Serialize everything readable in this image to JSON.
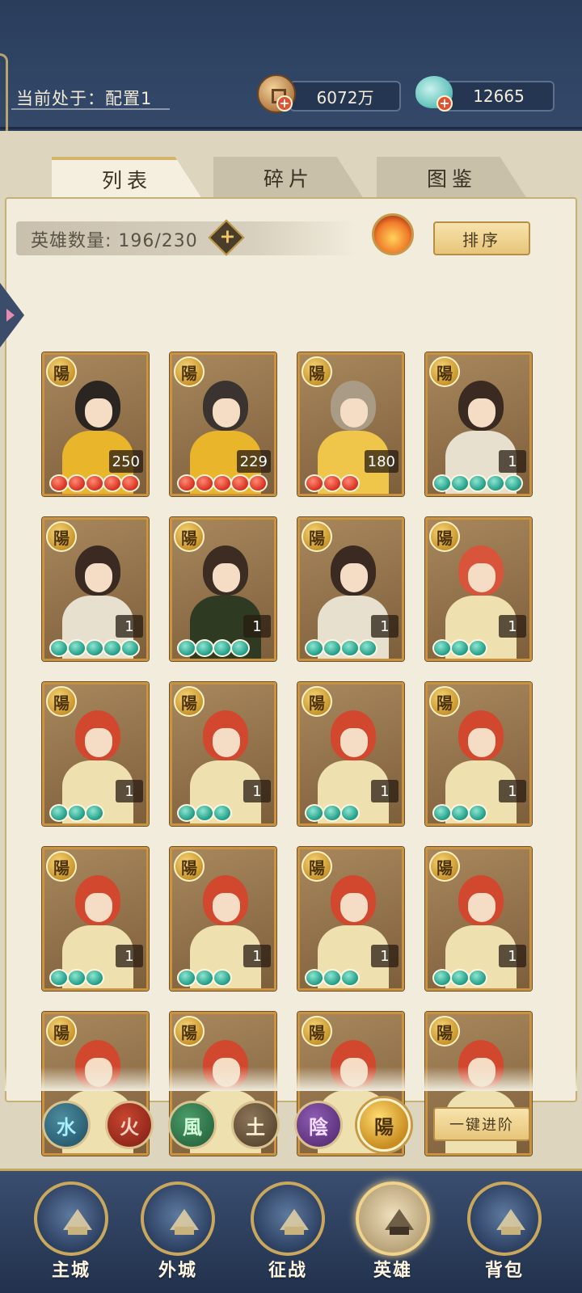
{
  "header": {
    "config_label": "当前处于：配置1",
    "coins": "6072万",
    "jade": "12665"
  },
  "tabs": [
    "列表",
    "碎片",
    "图鉴"
  ],
  "toolbar": {
    "hero_count_label": "英雄数量: 196/230",
    "plus_symbol": "+",
    "sort_label": "排序"
  },
  "heroes": [
    {
      "badge": "陽",
      "level": "250",
      "pips": 5,
      "pip_color": "red",
      "hair": "#2b2522",
      "outfit": "#e9b52b"
    },
    {
      "badge": "陽",
      "level": "229",
      "pips": 5,
      "pip_color": "red",
      "hair": "#3a3330",
      "outfit": "#e9b52b"
    },
    {
      "badge": "陽",
      "level": "180",
      "pips": 3,
      "pip_color": "red",
      "hair": "#a99b86",
      "outfit": "#f0c64a"
    },
    {
      "badge": "陽",
      "level": "1",
      "pips": 5,
      "pip_color": "teal",
      "hair": "#3b2a22",
      "outfit": "#e7e0cf"
    },
    {
      "badge": "陽",
      "level": "1",
      "pips": 5,
      "pip_color": "teal",
      "hair": "#3b2a22",
      "outfit": "#e7e0cf"
    },
    {
      "badge": "陽",
      "level": "1",
      "pips": 4,
      "pip_color": "teal",
      "hair": "#3d2c22",
      "outfit": "#2f3a22"
    },
    {
      "badge": "陽",
      "level": "1",
      "pips": 4,
      "pip_color": "teal",
      "hair": "#3b2a22",
      "outfit": "#e7e0cf"
    },
    {
      "badge": "陽",
      "level": "1",
      "pips": 3,
      "pip_color": "teal",
      "hair": "#d8553b",
      "outfit": "#efe0b0"
    },
    {
      "badge": "陽",
      "level": "1",
      "pips": 3,
      "pip_color": "teal",
      "hair": "#d2482f",
      "outfit": "#efe0b0"
    },
    {
      "badge": "陽",
      "level": "1",
      "pips": 3,
      "pip_color": "teal",
      "hair": "#d2482f",
      "outfit": "#efe0b0"
    },
    {
      "badge": "陽",
      "level": "1",
      "pips": 3,
      "pip_color": "teal",
      "hair": "#d2482f",
      "outfit": "#efe0b0"
    },
    {
      "badge": "陽",
      "level": "1",
      "pips": 3,
      "pip_color": "teal",
      "hair": "#d2482f",
      "outfit": "#efe0b0"
    },
    {
      "badge": "陽",
      "level": "1",
      "pips": 3,
      "pip_color": "teal",
      "hair": "#d2482f",
      "outfit": "#efe0b0"
    },
    {
      "badge": "陽",
      "level": "1",
      "pips": 3,
      "pip_color": "teal",
      "hair": "#d2482f",
      "outfit": "#efe0b0"
    },
    {
      "badge": "陽",
      "level": "1",
      "pips": 3,
      "pip_color": "teal",
      "hair": "#d2482f",
      "outfit": "#efe0b0"
    },
    {
      "badge": "陽",
      "level": "1",
      "pips": 3,
      "pip_color": "teal",
      "hair": "#d2482f",
      "outfit": "#efe0b0"
    },
    {
      "badge": "陽",
      "level": "",
      "pips": 0,
      "pip_color": "teal",
      "hair": "#d2482f",
      "outfit": "#efe0b0"
    },
    {
      "badge": "陽",
      "level": "",
      "pips": 0,
      "pip_color": "teal",
      "hair": "#d2482f",
      "outfit": "#efe0b0"
    },
    {
      "badge": "陽",
      "level": "",
      "pips": 0,
      "pip_color": "teal",
      "hair": "#d2482f",
      "outfit": "#efe0b0"
    },
    {
      "badge": "陽",
      "level": "",
      "pips": 0,
      "pip_color": "teal",
      "hair": "#d2482f",
      "outfit": "#efe0b0"
    }
  ],
  "element_filters": [
    {
      "glyph": "水",
      "key": "water"
    },
    {
      "glyph": "火",
      "key": "fire"
    },
    {
      "glyph": "風",
      "key": "wind"
    },
    {
      "glyph": "土",
      "key": "earth"
    },
    {
      "glyph": "陰",
      "key": "yin"
    },
    {
      "glyph": "陽",
      "key": "yang",
      "selected": true
    }
  ],
  "advance_label": "一键进阶",
  "nav": [
    {
      "label": "主城",
      "icon": "main-city-icon"
    },
    {
      "label": "外城",
      "icon": "outer-city-icon"
    },
    {
      "label": "征战",
      "icon": "campaign-icon"
    },
    {
      "label": "英雄",
      "icon": "hero-icon",
      "active": true
    },
    {
      "label": "背包",
      "icon": "backpack-icon"
    }
  ]
}
